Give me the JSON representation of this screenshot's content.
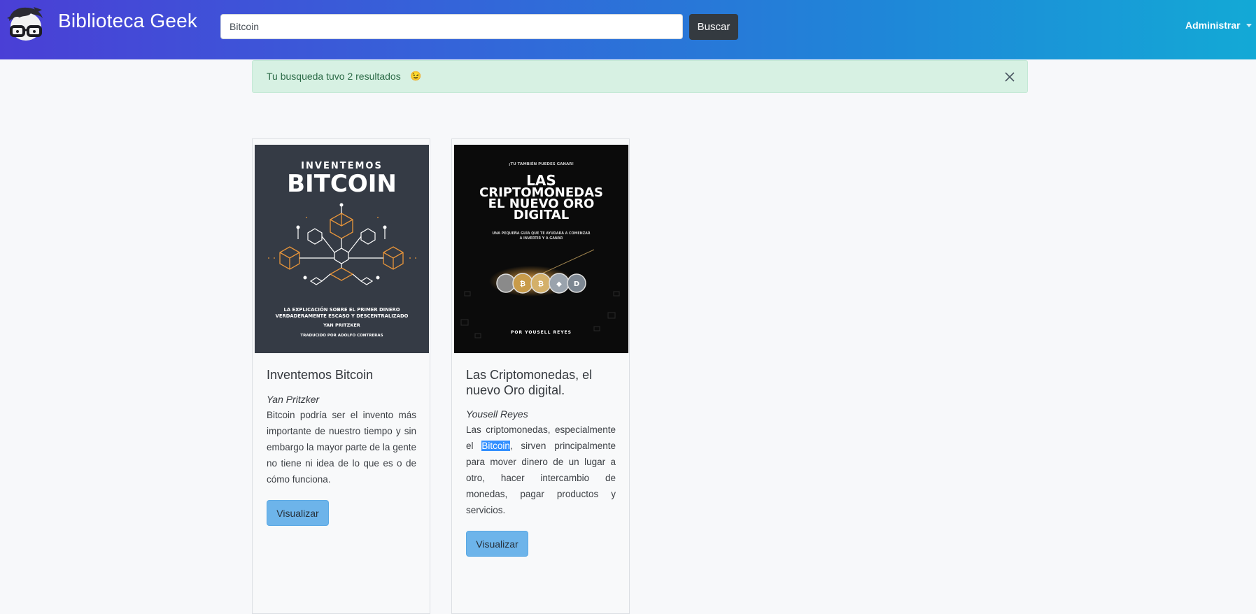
{
  "header": {
    "brand": "Biblioteca Geek",
    "search": {
      "value": "Bitcoin",
      "placeholder": ""
    },
    "search_button": "Buscar",
    "admin_menu": "Administrar"
  },
  "alert": {
    "message": "Tu busqueda tuvo 2 resultados",
    "emoji": "😉"
  },
  "books": [
    {
      "title": "Inventemos Bitcoin",
      "author": "Yan Pritzker",
      "description": "Bitcoin podría ser el invento más importante de nuestro tiempo y sin embargo la mayor parte de la gente no tiene ni idea de lo que es o de cómo funciona.",
      "button": "Visualizar",
      "cover": {
        "line1": "INVENTEMOS",
        "line2": "BITCOIN",
        "sub1": "LA EXPLICACIÓN SOBRE EL PRIMER DINERO",
        "sub2": "VERDADERAMENTE ESCASO Y DESCENTRALIZADO",
        "author": "YAN PRITZKER",
        "translator": "TRADUCIDO POR ADOLFO CONTRERAS",
        "bg": "#353b45",
        "accent": "#e8953a"
      }
    },
    {
      "title": "Las Criptomonedas, el nuevo Oro digital.",
      "author": "Yousell Reyes",
      "description_before": "Las criptomonedas, especialmente el ",
      "description_highlight": "Bitcoin",
      "description_after": ", sirven principalmente para mover dinero de un lugar a otro, hacer intercambio de monedas, pagar productos y servicios.",
      "button": "Visualizar",
      "cover": {
        "top": "¡TU TAMBIÉN PUEDES GANAR!",
        "line1": "LAS",
        "line2": "CRIPTOMONEDAS",
        "line3": "EL NUEVO ORO",
        "line4": "DIGITAL",
        "sub1": "UNA PEQUEÑA GUÍA QUE TE AYUDARÁ A COMENZAR",
        "sub2": "A INVERTIR Y A GANAR",
        "author": "POR YOUSELL REYES",
        "bg": "#0b0b0b"
      }
    }
  ]
}
